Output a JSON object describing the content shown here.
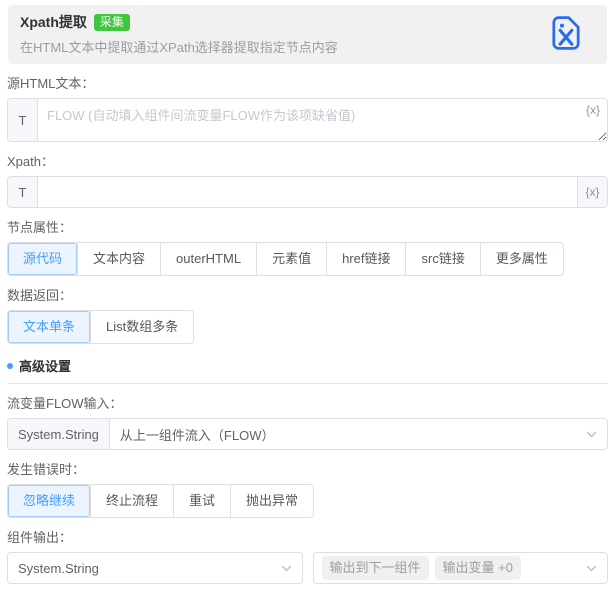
{
  "header": {
    "title": "Xpath提取",
    "badge": "采集",
    "description": "在HTML文本中提取通过XPath选择器提取指定节点内容"
  },
  "source_html": {
    "label": "源HTML文本：",
    "prefix": "T",
    "placeholder": "FLOW (自动填入组件间流变量FLOW作为该项缺省值)",
    "variable_token": "{x}"
  },
  "xpath": {
    "label": "Xpath：",
    "prefix": "T",
    "value": "",
    "variable_token": "{x}"
  },
  "node_attribute": {
    "label": "节点属性：",
    "options": [
      "源代码",
      "文本内容",
      "outerHTML",
      "元素值",
      "href链接",
      "src链接",
      "更多属性"
    ],
    "selected": "源代码"
  },
  "data_return": {
    "label": "数据返回：",
    "options": [
      "文本单条",
      "List数组多条"
    ],
    "selected": "文本单条"
  },
  "advanced": {
    "title": "高级设置"
  },
  "flow_input": {
    "label": "流变量FLOW输入：",
    "type_prefix": "System.String",
    "value": "从上一组件流入（FLOW）"
  },
  "on_error": {
    "label": "发生错误时：",
    "options": [
      "忽略继续",
      "终止流程",
      "重试",
      "抛出异常"
    ],
    "selected": "忽略继续"
  },
  "output": {
    "label": "组件输出：",
    "type_value": "System.String",
    "tags": [
      "输出到下一组件",
      "输出变量 +0"
    ]
  },
  "colors": {
    "accent_blue": "#409eff",
    "accent_blue_bg": "#ecf5ff",
    "badge_green": "#42c53e",
    "icon_blue": "#2a6cf0",
    "header_bg": "#f1f1f1"
  }
}
